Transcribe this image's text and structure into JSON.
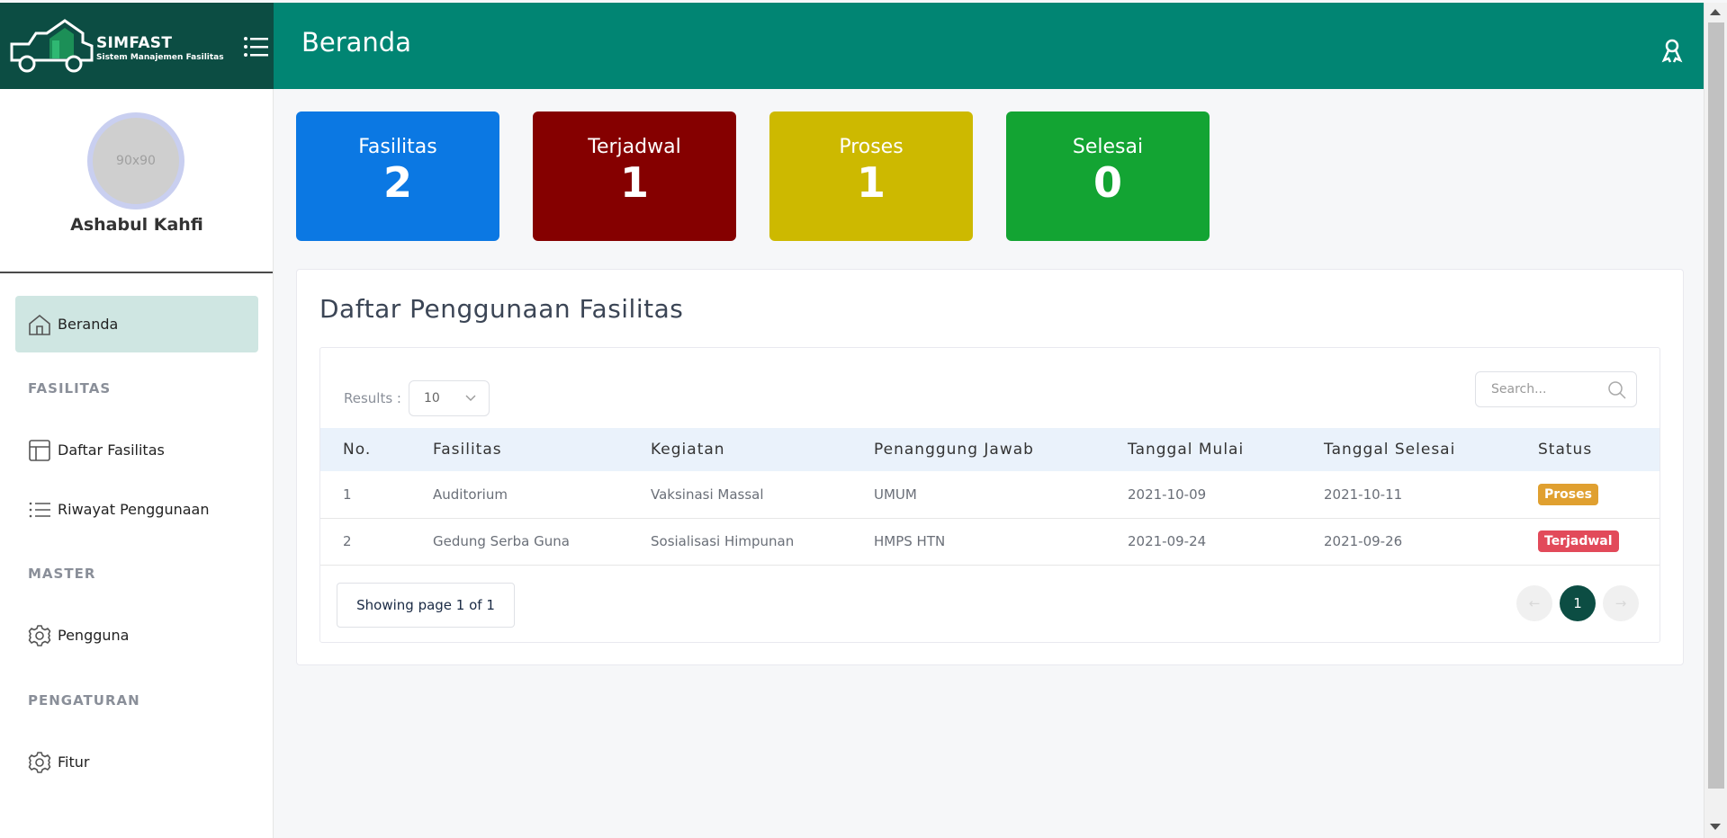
{
  "brand": {
    "title": "SIMFAST",
    "subtitle": "Sistem Manajemen Fasilitas"
  },
  "header": {
    "title": "Beranda"
  },
  "profile": {
    "avatar_placeholder": "90x90",
    "name": "Ashabul Kahfi"
  },
  "sidebar": {
    "active": {
      "label": "Beranda",
      "icon": "home-icon"
    },
    "sections": [
      {
        "heading": "FASILITAS",
        "items": [
          {
            "label": "Daftar Fasilitas",
            "icon": "layout-icon"
          },
          {
            "label": "Riwayat Penggunaan",
            "icon": "list-icon"
          }
        ]
      },
      {
        "heading": "MASTER",
        "items": [
          {
            "label": "Pengguna",
            "icon": "gear-icon"
          }
        ]
      },
      {
        "heading": "PENGATURAN",
        "items": [
          {
            "label": "Fitur",
            "icon": "gear-icon"
          }
        ]
      }
    ]
  },
  "stats": [
    {
      "label": "Fasilitas",
      "value": "2",
      "color": "#0b78e3"
    },
    {
      "label": "Terjadwal",
      "value": "1",
      "color": "#850000"
    },
    {
      "label": "Proses",
      "value": "1",
      "color": "#cdb900"
    },
    {
      "label": "Selesai",
      "value": "0",
      "color": "#13a433"
    }
  ],
  "panel": {
    "title": "Daftar Penggunaan Fasilitas",
    "results_label": "Results :",
    "results_value": "10",
    "search_placeholder": "Search...",
    "columns": [
      "No.",
      "Fasilitas",
      "Kegiatan",
      "Penanggung Jawab",
      "Tanggal Mulai",
      "Tanggal Selesai",
      "Status"
    ],
    "rows": [
      {
        "no": "1",
        "fasilitas": "Auditorium",
        "kegiatan": "Vaksinasi Massal",
        "pj": "UMUM",
        "mulai": "2021-10-09",
        "selesai": "2021-10-11",
        "status": "Proses",
        "status_color": "#e0a030"
      },
      {
        "no": "2",
        "fasilitas": "Gedung Serba Guna",
        "kegiatan": "Sosialisasi Himpunan",
        "pj": "HMPS HTN",
        "mulai": "2021-09-24",
        "selesai": "2021-09-26",
        "status": "Terjadwal",
        "status_color": "#e24a5a"
      }
    ],
    "showing": "Showing page 1 of 1",
    "pagination": {
      "prev": "←",
      "current": "1",
      "next": "→"
    }
  }
}
